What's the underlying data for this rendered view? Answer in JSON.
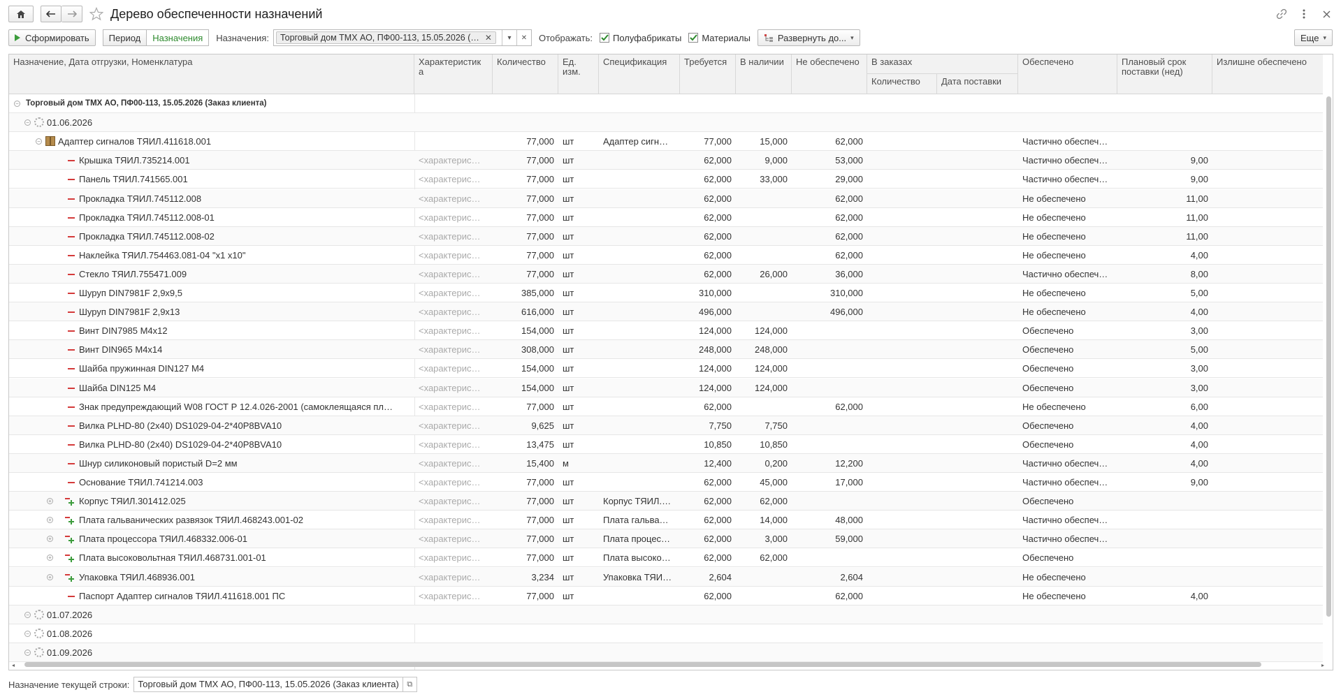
{
  "header": {
    "title": "Дерево обеспеченности назначений"
  },
  "toolbar": {
    "generate": "Сформировать",
    "period": "Период",
    "assignments_tab": "Назначения",
    "assignments_label": "Назначения:",
    "assignment_value": "Торговый дом ТМХ АО, ПФ00-113, 15.05.2026 (…",
    "show_label": "Отображать:",
    "semi_products": "Полуфабрикаты",
    "materials": "Материалы",
    "expand": "Развернуть до...",
    "more": "Еще"
  },
  "table": {
    "columns": [
      "Назначение, Дата отгрузки, Номенклатура",
      "Характеристик а",
      "Количество",
      "Ед. изм.",
      "Спецификация",
      "Требуется",
      "В наличии",
      "Не обеспечено",
      "В заказах",
      "Количество",
      "Дата поставки",
      "Обеспечено",
      "Плановый срок поставки (нед)",
      "Излишне обеспечено"
    ],
    "rows": [
      {
        "lvl": 0,
        "icon": "toggle-open",
        "name": "Торговый дом ТМХ АО, ПФ00-113, 15.05.2026 (Заказ клиента)",
        "bold": true,
        "char": "",
        "qty": "",
        "uom": "",
        "spec": "",
        "req": "",
        "avail": "",
        "notprov": "",
        "ordqty": "",
        "orddate": "",
        "prov": "",
        "lead": "",
        "excess": ""
      },
      {
        "lvl": 1,
        "icon": "gear",
        "name": "01.06.2026",
        "char": "",
        "qty": "",
        "uom": "",
        "spec": "",
        "req": "",
        "avail": "",
        "notprov": "",
        "ordqty": "",
        "orddate": "",
        "prov": "",
        "lead": "",
        "excess": ""
      },
      {
        "lvl": 2,
        "icon": "box",
        "name": "Адаптер сигналов ТЯИЛ.411618.001",
        "char": "",
        "qty": "77,000",
        "uom": "шт",
        "spec": "Адаптер сигн…",
        "req": "77,000",
        "avail": "15,000",
        "notprov": "62,000",
        "ordqty": "",
        "orddate": "",
        "prov": "Частично обеспеч…",
        "lead": "",
        "excess": ""
      },
      {
        "lvl": 3,
        "icon": "minus",
        "name": "Крышка ТЯИЛ.735214.001",
        "char": "<характерис…",
        "qty": "77,000",
        "uom": "шт",
        "spec": "",
        "req": "62,000",
        "avail": "9,000",
        "notprov": "53,000",
        "ordqty": "",
        "orddate": "",
        "prov": "Частично обеспеч…",
        "lead": "9,00",
        "excess": ""
      },
      {
        "lvl": 3,
        "icon": "minus",
        "name": "Панель ТЯИЛ.741565.001",
        "char": "<характерис…",
        "qty": "77,000",
        "uom": "шт",
        "spec": "",
        "req": "62,000",
        "avail": "33,000",
        "notprov": "29,000",
        "ordqty": "",
        "orddate": "",
        "prov": "Частично обеспеч…",
        "lead": "9,00",
        "excess": ""
      },
      {
        "lvl": 3,
        "icon": "minus",
        "name": "Прокладка ТЯИЛ.745112.008",
        "char": "<характерис…",
        "qty": "77,000",
        "uom": "шт",
        "spec": "",
        "req": "62,000",
        "avail": "",
        "notprov": "62,000",
        "ordqty": "",
        "orddate": "",
        "prov": "Не обеспечено",
        "lead": "11,00",
        "excess": ""
      },
      {
        "lvl": 3,
        "icon": "minus",
        "name": "Прокладка ТЯИЛ.745112.008-01",
        "char": "<характерис…",
        "qty": "77,000",
        "uom": "шт",
        "spec": "",
        "req": "62,000",
        "avail": "",
        "notprov": "62,000",
        "ordqty": "",
        "orddate": "",
        "prov": "Не обеспечено",
        "lead": "11,00",
        "excess": ""
      },
      {
        "lvl": 3,
        "icon": "minus",
        "name": "Прокладка ТЯИЛ.745112.008-02",
        "char": "<характерис…",
        "qty": "77,000",
        "uom": "шт",
        "spec": "",
        "req": "62,000",
        "avail": "",
        "notprov": "62,000",
        "ordqty": "",
        "orddate": "",
        "prov": "Не обеспечено",
        "lead": "11,00",
        "excess": ""
      },
      {
        "lvl": 3,
        "icon": "minus",
        "name": "Наклейка ТЯИЛ.754463.081-04 \"x1 x10\"",
        "char": "<характерис…",
        "qty": "77,000",
        "uom": "шт",
        "spec": "",
        "req": "62,000",
        "avail": "",
        "notprov": "62,000",
        "ordqty": "",
        "orddate": "",
        "prov": "Не обеспечено",
        "lead": "4,00",
        "excess": ""
      },
      {
        "lvl": 3,
        "icon": "minus",
        "name": "Стекло ТЯИЛ.755471.009",
        "char": "<характерис…",
        "qty": "77,000",
        "uom": "шт",
        "spec": "",
        "req": "62,000",
        "avail": "26,000",
        "notprov": "36,000",
        "ordqty": "",
        "orddate": "",
        "prov": "Частично обеспеч…",
        "lead": "8,00",
        "excess": ""
      },
      {
        "lvl": 3,
        "icon": "minus",
        "name": "Шуруп DIN7981F 2,9x9,5",
        "char": "<характерис…",
        "qty": "385,000",
        "uom": "шт",
        "spec": "",
        "req": "310,000",
        "avail": "",
        "notprov": "310,000",
        "ordqty": "",
        "orddate": "",
        "prov": "Не обеспечено",
        "lead": "5,00",
        "excess": ""
      },
      {
        "lvl": 3,
        "icon": "minus",
        "name": "Шуруп DIN7981F 2,9x13",
        "char": "<характерис…",
        "qty": "616,000",
        "uom": "шт",
        "spec": "",
        "req": "496,000",
        "avail": "",
        "notprov": "496,000",
        "ordqty": "",
        "orddate": "",
        "prov": "Не обеспечено",
        "lead": "4,00",
        "excess": ""
      },
      {
        "lvl": 3,
        "icon": "minus",
        "name": "Винт DIN7985 M4x12",
        "char": "<характерис…",
        "qty": "154,000",
        "uom": "шт",
        "spec": "",
        "req": "124,000",
        "avail": "124,000",
        "notprov": "",
        "ordqty": "",
        "orddate": "",
        "prov": "Обеспечено",
        "lead": "3,00",
        "excess": ""
      },
      {
        "lvl": 3,
        "icon": "minus",
        "name": "Винт DIN965 M4x14",
        "char": "<характерис…",
        "qty": "308,000",
        "uom": "шт",
        "spec": "",
        "req": "248,000",
        "avail": "248,000",
        "notprov": "",
        "ordqty": "",
        "orddate": "",
        "prov": "Обеспечено",
        "lead": "5,00",
        "excess": ""
      },
      {
        "lvl": 3,
        "icon": "minus",
        "name": "Шайба пружинная DIN127 M4",
        "char": "<характерис…",
        "qty": "154,000",
        "uom": "шт",
        "spec": "",
        "req": "124,000",
        "avail": "124,000",
        "notprov": "",
        "ordqty": "",
        "orddate": "",
        "prov": "Обеспечено",
        "lead": "3,00",
        "excess": ""
      },
      {
        "lvl": 3,
        "icon": "minus",
        "name": "Шайба DIN125 M4",
        "char": "<характерис…",
        "qty": "154,000",
        "uom": "шт",
        "spec": "",
        "req": "124,000",
        "avail": "124,000",
        "notprov": "",
        "ordqty": "",
        "orddate": "",
        "prov": "Обеспечено",
        "lead": "3,00",
        "excess": ""
      },
      {
        "lvl": 3,
        "icon": "minus",
        "name": "Знак предупреждающий W08 ГОСТ Р 12.4.026-2001 (самоклеящаяся пл…",
        "char": "<характерис…",
        "qty": "77,000",
        "uom": "шт",
        "spec": "",
        "req": "62,000",
        "avail": "",
        "notprov": "62,000",
        "ordqty": "",
        "orddate": "",
        "prov": "Не обеспечено",
        "lead": "6,00",
        "excess": ""
      },
      {
        "lvl": 3,
        "icon": "minus",
        "name": "Вилка PLHD-80 (2x40) DS1029-04-2*40P8BVA10",
        "char": "<характерис…",
        "qty": "9,625",
        "uom": "шт",
        "spec": "",
        "req": "7,750",
        "avail": "7,750",
        "notprov": "",
        "ordqty": "",
        "orddate": "",
        "prov": "Обеспечено",
        "lead": "4,00",
        "excess": ""
      },
      {
        "lvl": 3,
        "icon": "minus",
        "name": "Вилка PLHD-80 (2x40) DS1029-04-2*40P8BVA10",
        "char": "<характерис…",
        "qty": "13,475",
        "uom": "шт",
        "spec": "",
        "req": "10,850",
        "avail": "10,850",
        "notprov": "",
        "ordqty": "",
        "orddate": "",
        "prov": "Обеспечено",
        "lead": "4,00",
        "excess": ""
      },
      {
        "lvl": 3,
        "icon": "minus",
        "name": "Шнур силиконовый пористый D=2 мм",
        "char": "<характерис…",
        "qty": "15,400",
        "uom": "м",
        "spec": "",
        "req": "12,400",
        "avail": "0,200",
        "notprov": "12,200",
        "ordqty": "",
        "orddate": "",
        "prov": "Частично обеспеч…",
        "lead": "4,00",
        "excess": ""
      },
      {
        "lvl": 3,
        "icon": "minus",
        "name": "Основание ТЯИЛ.741214.003",
        "char": "<характерис…",
        "qty": "77,000",
        "uom": "шт",
        "spec": "",
        "req": "62,000",
        "avail": "45,000",
        "notprov": "17,000",
        "ordqty": "",
        "orddate": "",
        "prov": "Частично обеспеч…",
        "lead": "9,00",
        "excess": ""
      },
      {
        "lvl": 3,
        "icon": "plus",
        "name": "Корпус ТЯИЛ.301412.025",
        "char": "<характерис…",
        "qty": "77,000",
        "uom": "шт",
        "spec": "Корпус ТЯИЛ.…",
        "req": "62,000",
        "avail": "62,000",
        "notprov": "",
        "ordqty": "",
        "orddate": "",
        "prov": "Обеспечено",
        "lead": "",
        "excess": ""
      },
      {
        "lvl": 3,
        "icon": "plus",
        "name": "Плата гальванических развязок ТЯИЛ.468243.001-02",
        "char": "<характерис…",
        "qty": "77,000",
        "uom": "шт",
        "spec": "Плата гальва…",
        "req": "62,000",
        "avail": "14,000",
        "notprov": "48,000",
        "ordqty": "",
        "orddate": "",
        "prov": "Частично обеспеч…",
        "lead": "",
        "excess": ""
      },
      {
        "lvl": 3,
        "icon": "plus",
        "name": "Плата процессора ТЯИЛ.468332.006-01",
        "char": "<характерис…",
        "qty": "77,000",
        "uom": "шт",
        "spec": "Плата процес…",
        "req": "62,000",
        "avail": "3,000",
        "notprov": "59,000",
        "ordqty": "",
        "orddate": "",
        "prov": "Частично обеспеч…",
        "lead": "",
        "excess": ""
      },
      {
        "lvl": 3,
        "icon": "plus",
        "name": "Плата высоковольтная ТЯИЛ.468731.001-01",
        "char": "<характерис…",
        "qty": "77,000",
        "uom": "шт",
        "spec": "Плата высоко…",
        "req": "62,000",
        "avail": "62,000",
        "notprov": "",
        "ordqty": "",
        "orddate": "",
        "prov": "Обеспечено",
        "lead": "",
        "excess": ""
      },
      {
        "lvl": 3,
        "icon": "plus",
        "name": "Упаковка ТЯИЛ.468936.001",
        "char": "<характерис…",
        "qty": "3,234",
        "uom": "шт",
        "spec": "Упаковка ТЯИ…",
        "req": "2,604",
        "avail": "",
        "notprov": "2,604",
        "ordqty": "",
        "orddate": "",
        "prov": "Не обеспечено",
        "lead": "",
        "excess": ""
      },
      {
        "lvl": 3,
        "icon": "minus",
        "name": "Паспорт Адаптер сигналов ТЯИЛ.411618.001 ПС",
        "char": "<характерис…",
        "qty": "77,000",
        "uom": "шт",
        "spec": "",
        "req": "62,000",
        "avail": "",
        "notprov": "62,000",
        "ordqty": "",
        "orddate": "",
        "prov": "Не обеспечено",
        "lead": "4,00",
        "excess": ""
      },
      {
        "lvl": 1,
        "icon": "gear",
        "name": "01.07.2026",
        "char": "",
        "qty": "",
        "uom": "",
        "spec": "",
        "req": "",
        "avail": "",
        "notprov": "",
        "ordqty": "",
        "orddate": "",
        "prov": "",
        "lead": "",
        "excess": ""
      },
      {
        "lvl": 1,
        "icon": "gear",
        "name": "01.08.2026",
        "char": "",
        "qty": "",
        "uom": "",
        "spec": "",
        "req": "",
        "avail": "",
        "notprov": "",
        "ordqty": "",
        "orddate": "",
        "prov": "",
        "lead": "",
        "excess": ""
      },
      {
        "lvl": 1,
        "icon": "gear",
        "name": "01.09.2026",
        "char": "",
        "qty": "",
        "uom": "",
        "spec": "",
        "req": "",
        "avail": "",
        "notprov": "",
        "ordqty": "",
        "orddate": "",
        "prov": "",
        "lead": "",
        "excess": ""
      }
    ]
  },
  "footer": {
    "label": "Назначение текущей строки:",
    "value": "Торговый дом ТМХ АО, ПФ00-113, 15.05.2026 (Заказ клиента)"
  }
}
